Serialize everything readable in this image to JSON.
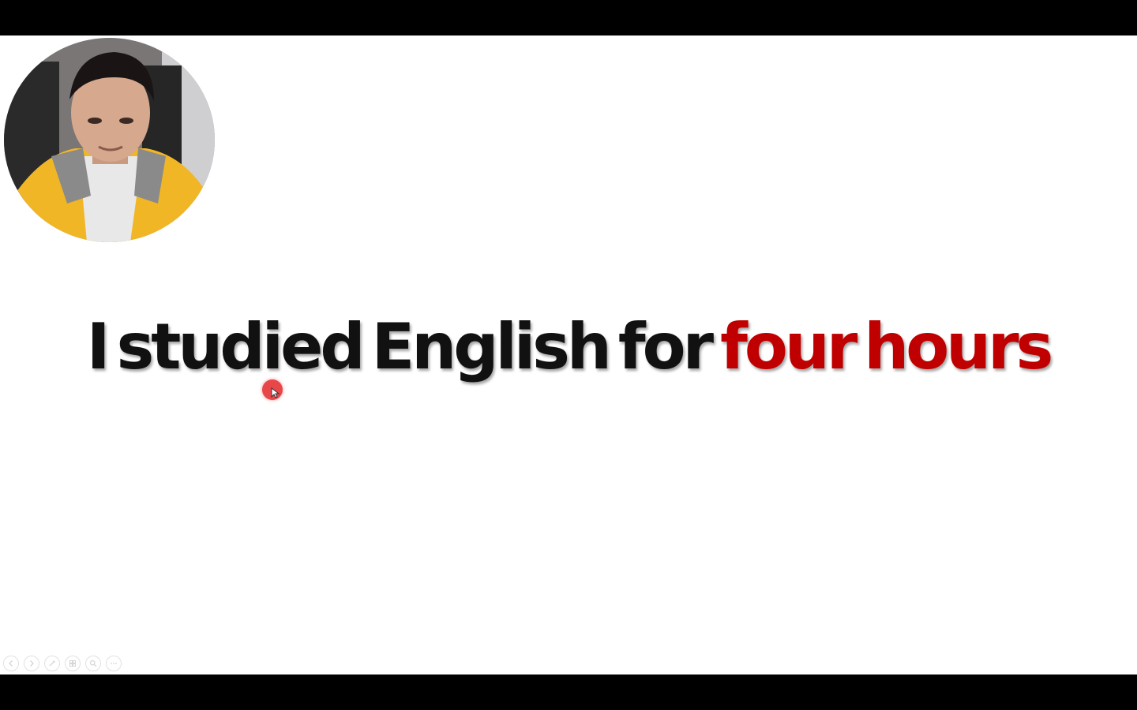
{
  "slide": {
    "words": [
      {
        "text": "I",
        "color": "#111111"
      },
      {
        "text": "studied",
        "color": "#111111"
      },
      {
        "text": "English",
        "color": "#111111"
      },
      {
        "text": "for",
        "color": "#111111"
      },
      {
        "text": "four",
        "color": "#c00000"
      },
      {
        "text": "hours",
        "color": "#c00000"
      }
    ]
  },
  "webcam": {
    "icon": "presenter-video-thumbnail"
  },
  "pointer": {
    "icon": "laser-pointer-icon",
    "color": "#e8474a"
  },
  "controls": {
    "items": [
      {
        "name": "previous-slide-button",
        "icon": "arrow-left-icon"
      },
      {
        "name": "next-slide-button",
        "icon": "arrow-right-icon"
      },
      {
        "name": "pen-tool-button",
        "icon": "pen-icon"
      },
      {
        "name": "see-all-slides-button",
        "icon": "grid-icon"
      },
      {
        "name": "zoom-button",
        "icon": "magnifier-icon"
      },
      {
        "name": "more-options-button",
        "icon": "ellipsis-icon"
      }
    ]
  }
}
